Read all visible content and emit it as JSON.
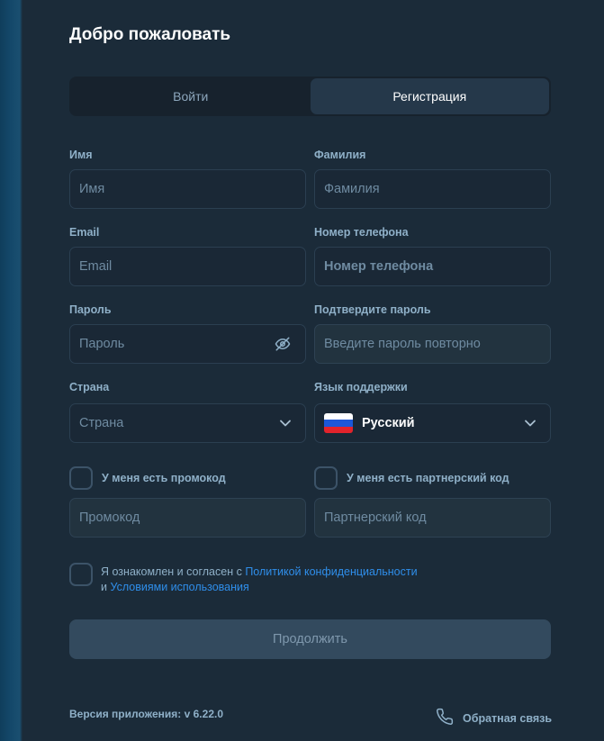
{
  "header": {
    "title": "Добро пожаловать"
  },
  "tabs": [
    {
      "label": "Войти",
      "active": false
    },
    {
      "label": "Регистрация",
      "active": true
    }
  ],
  "form": {
    "first_name": {
      "label": "Имя",
      "placeholder": "Имя",
      "value": ""
    },
    "last_name": {
      "label": "Фамилия",
      "placeholder": "Фамилия",
      "value": ""
    },
    "email": {
      "label": "Email",
      "placeholder": "Email",
      "value": ""
    },
    "phone": {
      "label": "Номер телефона",
      "placeholder": "Номер телефона",
      "value": ""
    },
    "password": {
      "label": "Пароль",
      "placeholder": "Пароль",
      "value": "",
      "icon": "eye-off-icon"
    },
    "confirm_password": {
      "label": "Подтвердите пароль",
      "placeholder": "Введите пароль повторно",
      "value": ""
    },
    "country": {
      "label": "Страна",
      "selected": "Страна",
      "icon": "chevron-down-icon"
    },
    "support_language": {
      "label": "Язык поддержки",
      "selected": "Русский",
      "flag": "russia-flag-icon",
      "icon": "chevron-down-icon"
    },
    "promo": {
      "checkbox_label": "У меня есть промокод",
      "checked": false,
      "placeholder": "Промокод",
      "value": ""
    },
    "partner": {
      "checkbox_label": "У меня есть партнерский код",
      "checked": false,
      "placeholder": "Партнерский код",
      "value": ""
    },
    "agreement": {
      "checked": false,
      "text_before": "Я ознакомлен и согласен с ",
      "privacy_link": "Политикой конфиденциальности",
      "conjunction": "и ",
      "terms_link": "Условиями использования"
    },
    "submit_label": "Продолжить"
  },
  "footer": {
    "version": "Версия приложения: v 6.22.0",
    "feedback_label": "Обратная связь",
    "feedback_icon": "phone-icon"
  },
  "colors": {
    "background": "#1b2b39",
    "accent_link": "#2f8eea",
    "label": "#8fb0c8",
    "submit_disabled": "#334a5e"
  }
}
